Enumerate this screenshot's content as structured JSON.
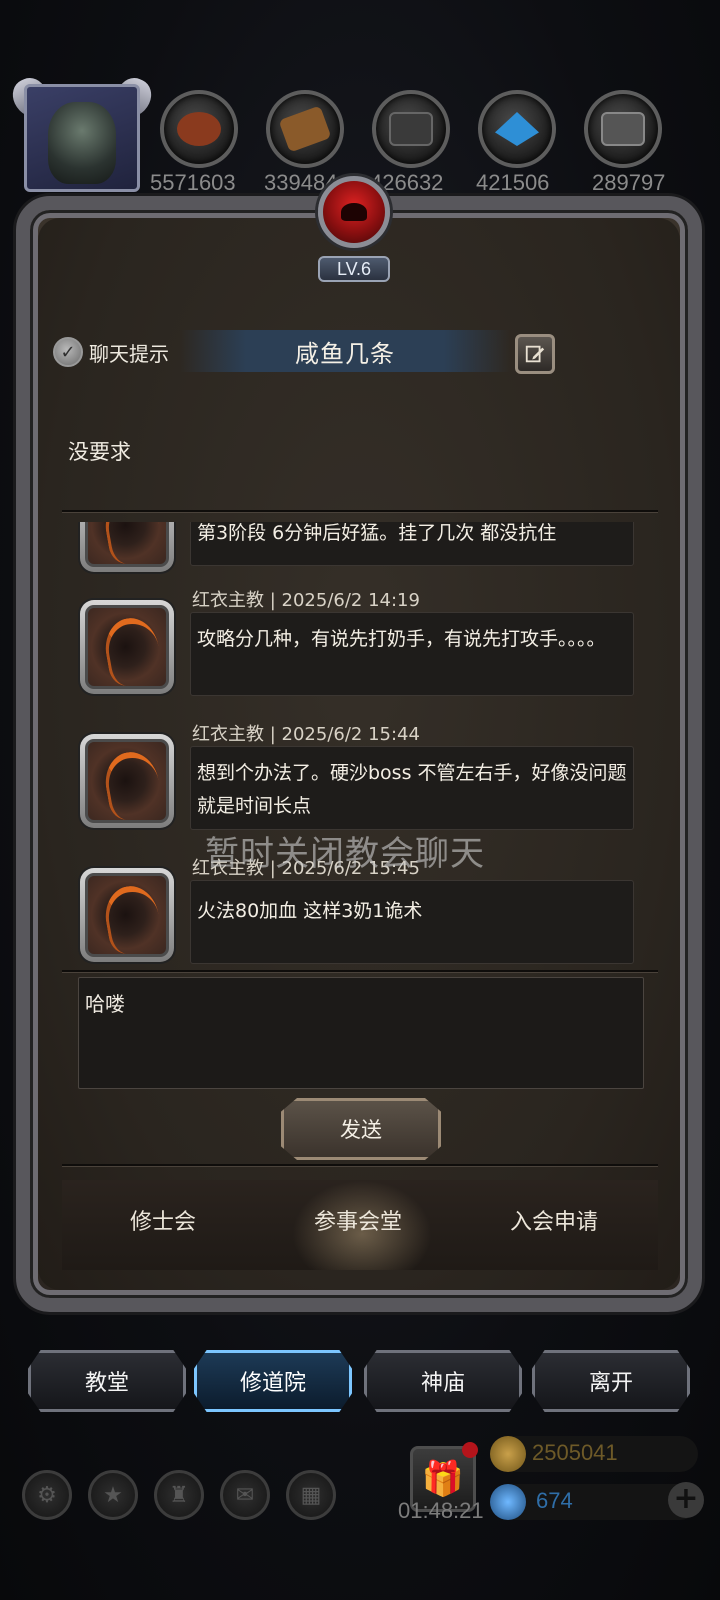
{
  "resources": [
    {
      "name": "meat-icon",
      "value": "5571603",
      "color": "#8a3a1e"
    },
    {
      "name": "wood-icon",
      "value": "339484",
      "color": "#8a5a2a"
    },
    {
      "name": "stone-icon",
      "value": "426632",
      "color": "#4a4a4a"
    },
    {
      "name": "crystal-icon",
      "value": "421506",
      "color": "#2e8fd6"
    },
    {
      "name": "iron-icon",
      "value": "289797",
      "color": "#555555"
    }
  ],
  "panel": {
    "level": "LV.6",
    "chat_toggle_label": "聊天提示",
    "title": "咸鱼几条",
    "notice": "没要求"
  },
  "messages": [
    {
      "meta": "",
      "text": "第3阶段  6分钟后好猛。挂了几次 都没抗住"
    },
    {
      "meta": "红衣主教 | 2025/6/2 14:19",
      "text": "攻略分几种，有说先打奶手，有说先打攻手。。。。"
    },
    {
      "meta": "红衣主教 | 2025/6/2 15:44",
      "text": "想到个办法了。硬沙boss 不管左右手，好像没问题就是时间长点"
    },
    {
      "meta": "红衣主教 | 2025/6/2 15:45",
      "text": "火法80加血 这样3奶1诡术"
    }
  ],
  "overlay_note": "暂时关闭教会聊天",
  "input": {
    "value": "哈喽"
  },
  "send_label": "发送",
  "tabs": [
    "修士会",
    "参事会堂",
    "入会申请"
  ],
  "nav": [
    {
      "label": "教堂",
      "active": false
    },
    {
      "label": "修道院",
      "active": true
    },
    {
      "label": "神庙",
      "active": false
    },
    {
      "label": "离开",
      "active": false
    }
  ],
  "bottom": {
    "timer": "01:48:21",
    "gold": "2505041",
    "gems": "674",
    "gold_color": "#8a6a1e",
    "gem_color": "#2f6ea8"
  }
}
